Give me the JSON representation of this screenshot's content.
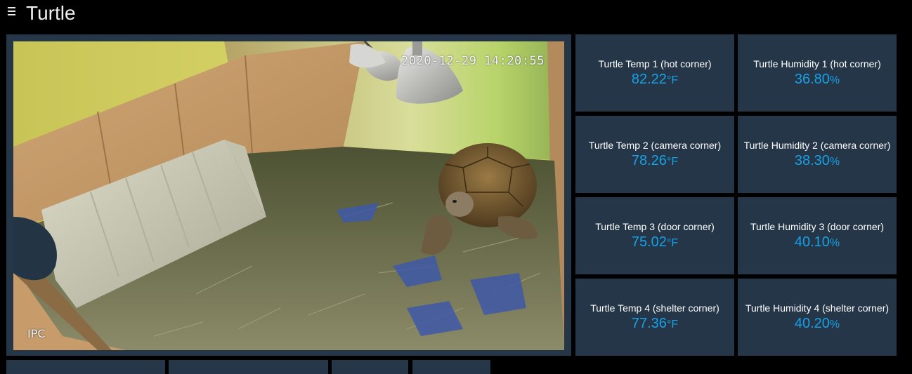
{
  "header": {
    "title": "Turtle",
    "menu_icon": "hamburger-menu-icon"
  },
  "camera": {
    "timestamp": "2020-12-29 14:20:55",
    "brand": "IPC"
  },
  "sensors": [
    {
      "label": "Turtle Temp 1 (hot corner)",
      "value": "82.22",
      "unit": "°F"
    },
    {
      "label": "Turtle Humidity 1 (hot corner)",
      "value": "36.80",
      "unit": "%"
    },
    {
      "label": "Turtle Temp 2 (camera corner)",
      "value": "78.26",
      "unit": "°F"
    },
    {
      "label": "Turtle Humidity 2 (camera corner)",
      "value": "38.30",
      "unit": "%"
    },
    {
      "label": "Turtle Temp 3 (door corner)",
      "value": "75.02",
      "unit": "°F"
    },
    {
      "label": "Turtle Humidity 3 (door corner)",
      "value": "40.10",
      "unit": "%"
    },
    {
      "label": "Turtle Temp 4 (shelter corner)",
      "value": "77.36",
      "unit": "°F"
    },
    {
      "label": "Turtle Humidity 4 (shelter corner)",
      "value": "40.20",
      "unit": "%"
    }
  ],
  "colors": {
    "background": "#000000",
    "tile": "#243647",
    "value_accent": "#17a2e8",
    "text": "#ffffff"
  }
}
